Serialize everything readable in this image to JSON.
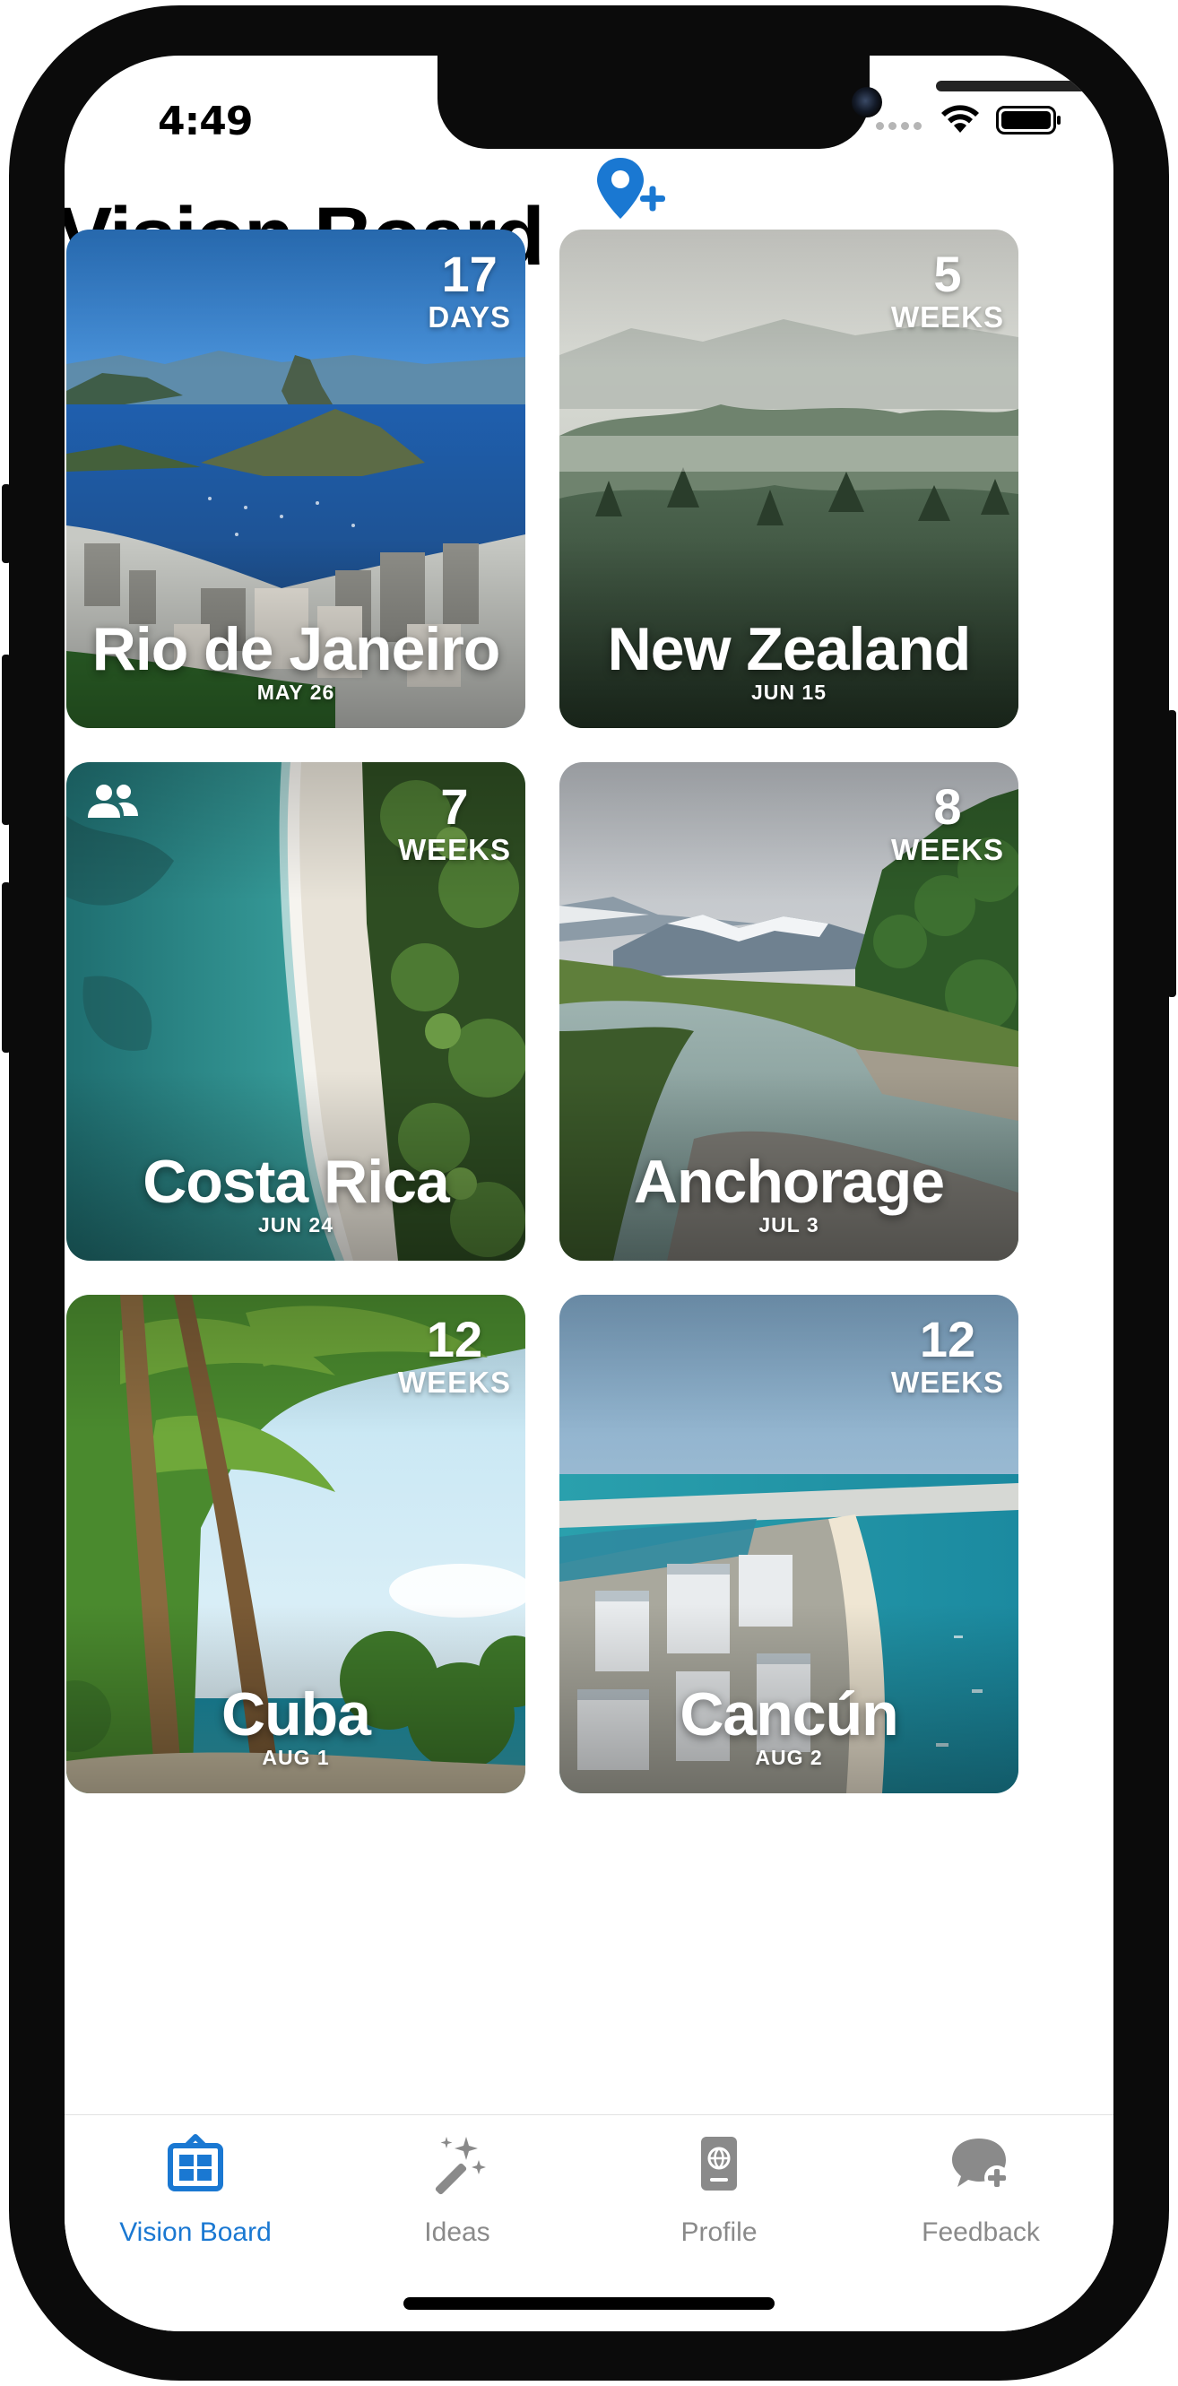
{
  "status_bar": {
    "time": "4:49"
  },
  "header": {
    "title": "Vision Board",
    "add_icon": "map-pin-plus-icon"
  },
  "accent_color": "#1a78d2",
  "destinations": [
    {
      "name": "Rio de Janeiro",
      "date": "MAY 26",
      "countdown_value": "17",
      "countdown_unit": "DAYS",
      "shared": false
    },
    {
      "name": "New Zealand",
      "date": "JUN 15",
      "countdown_value": "5",
      "countdown_unit": "WEEKS",
      "shared": false
    },
    {
      "name": "Costa Rica",
      "date": "JUN 24",
      "countdown_value": "7",
      "countdown_unit": "WEEKS",
      "shared": true
    },
    {
      "name": "Anchorage",
      "date": "JUL 3",
      "countdown_value": "8",
      "countdown_unit": "WEEKS",
      "shared": false
    },
    {
      "name": "Cuba",
      "date": "AUG 1",
      "countdown_value": "12",
      "countdown_unit": "WEEKS",
      "shared": false
    },
    {
      "name": "Cancún",
      "date": "AUG 2",
      "countdown_value": "12",
      "countdown_unit": "WEEKS",
      "shared": false
    }
  ],
  "tabs": [
    {
      "label": "Vision Board",
      "icon": "vision-board-icon",
      "active": true
    },
    {
      "label": "Ideas",
      "icon": "magic-wand-icon",
      "active": false
    },
    {
      "label": "Profile",
      "icon": "passport-icon",
      "active": false
    },
    {
      "label": "Feedback",
      "icon": "chat-bubble-plus-icon",
      "active": false
    }
  ]
}
